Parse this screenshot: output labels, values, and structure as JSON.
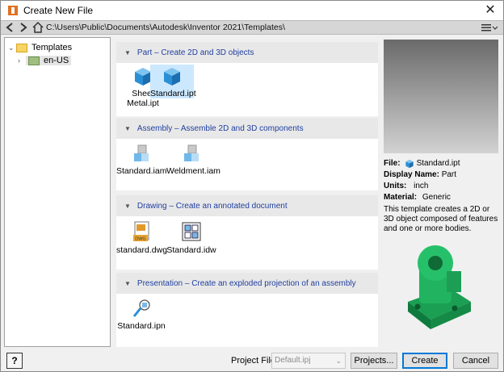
{
  "window": {
    "title": "Create New File",
    "close_glyph": "✕"
  },
  "pathbar": {
    "path": "C:\\Users\\Public\\Documents\\Autodesk\\Inventor 2021\\Templates\\"
  },
  "tree": {
    "root": "Templates",
    "child": "en-US"
  },
  "sections": [
    {
      "header": "Part – Create 2D and 3D objects",
      "items": [
        {
          "label1": "Sheet",
          "label2": "Metal.ipt",
          "icon": "part-cube-icon"
        },
        {
          "label1": "Standard.ipt",
          "label2": "",
          "icon": "part-cube-icon",
          "selected": true
        }
      ]
    },
    {
      "header": "Assembly – Assemble 2D and 3D components",
      "items": [
        {
          "label1": "Standard.iam",
          "icon": "assembly-icon"
        },
        {
          "label1": "Weldment.iam",
          "icon": "assembly-icon"
        }
      ]
    },
    {
      "header": "Drawing – Create an annotated document",
      "items": [
        {
          "label1": "standard.dwg",
          "icon": "dwg-icon"
        },
        {
          "label1": "Standard.idw",
          "icon": "idw-icon"
        }
      ]
    },
    {
      "header": "Presentation – Create an exploded projection of an assembly",
      "items": [
        {
          "label1": "Standard.ipn",
          "icon": "presentation-icon"
        }
      ]
    }
  ],
  "details": {
    "file_label": "File:",
    "file_value": "Standard.ipt",
    "display_name_label": "Display Name:",
    "display_name_value": "Part",
    "units_label": "Units:",
    "units_value": "inch",
    "material_label": "Material:",
    "material_value": "Generic",
    "description": "This template creates a 2D or 3D object composed of features and one or more bodies."
  },
  "bottom": {
    "help_label": "?",
    "project_file_label": "Project File:",
    "project_file_value": "Default.ipj",
    "projects_button": "Projects...",
    "create_button": "Create",
    "cancel_button": "Cancel"
  },
  "colors": {
    "accent": "#0078d7",
    "section_text": "#1f3f9f",
    "selected_bg": "#cce8ff",
    "thumb_green": "#1fae5a"
  }
}
